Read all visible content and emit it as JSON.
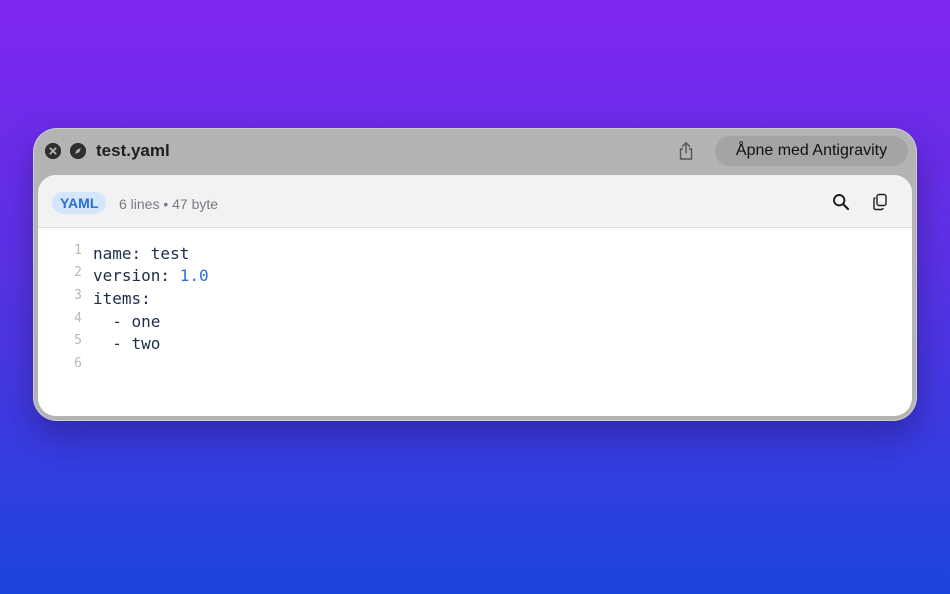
{
  "window": {
    "title": "test.yaml",
    "open_button_label": "Åpne med Antigravity"
  },
  "toolbar": {
    "language_badge": "YAML",
    "meta": "6 lines • 47 byte"
  },
  "icons": {
    "close": "close-icon",
    "navigate": "compass-icon",
    "share": "share-icon",
    "search": "search-icon",
    "copy": "copy-icon"
  },
  "code": {
    "lines": [
      {
        "n": "1",
        "key": "name: ",
        "value": "test",
        "value_type": "string"
      },
      {
        "n": "2",
        "key": "version: ",
        "value": "1.0",
        "value_type": "number"
      },
      {
        "n": "3",
        "key": "items:",
        "value": "",
        "value_type": "string"
      },
      {
        "n": "4",
        "key": "  - ",
        "value": "one",
        "value_type": "string"
      },
      {
        "n": "5",
        "key": "  - ",
        "value": "two",
        "value_type": "string"
      },
      {
        "n": "6",
        "key": "",
        "value": "",
        "value_type": "string"
      }
    ]
  },
  "colors": {
    "background_top": "#7f26ee",
    "background_bottom": "#1b44dc",
    "badge_text": "#2a6fd4",
    "number_literal": "#2a6fd4",
    "code_text": "#1d2e48"
  }
}
